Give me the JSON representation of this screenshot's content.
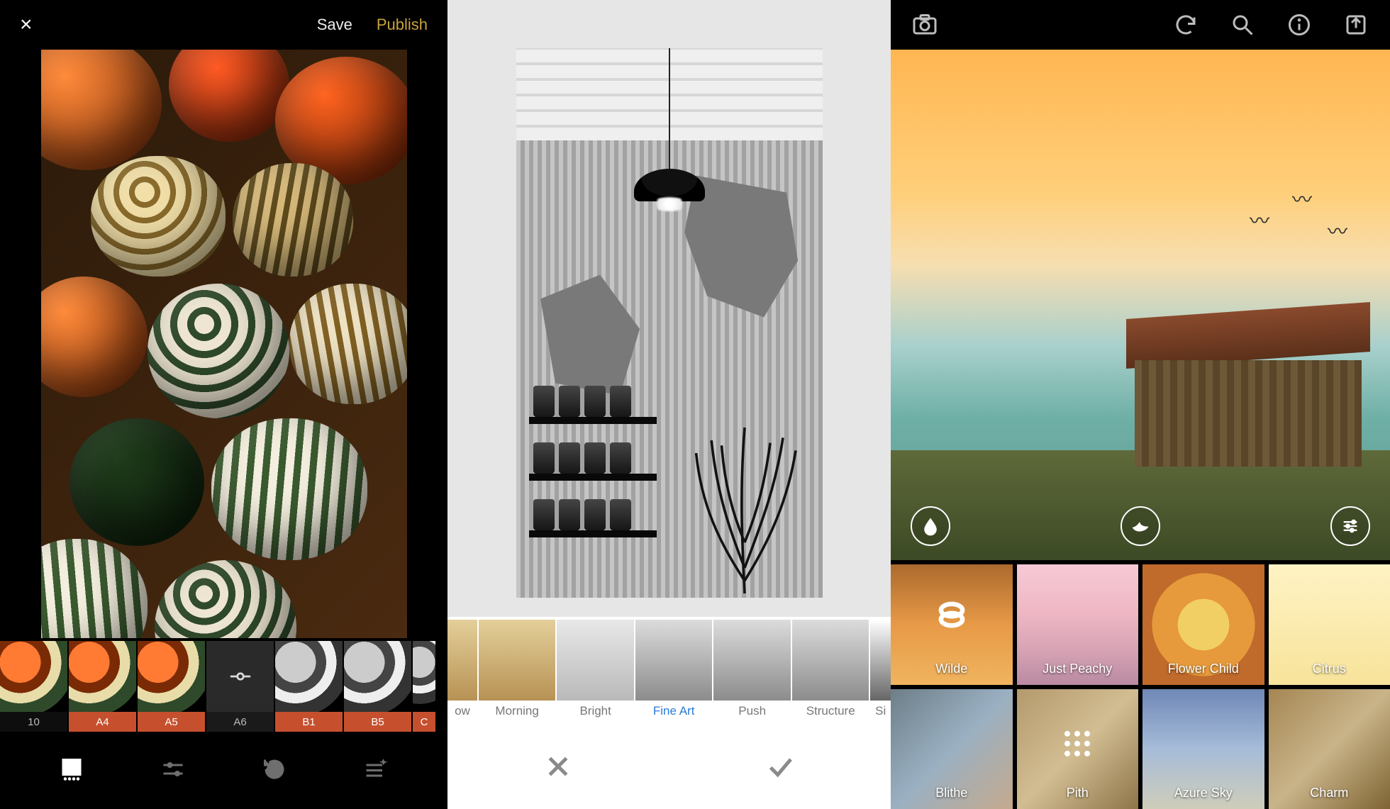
{
  "panelA": {
    "close_icon": "×",
    "save_label": "Save",
    "publish_label": "Publish",
    "publish_color": "#c9a23e",
    "filters": [
      {
        "label": "10",
        "style": "plain",
        "thumb": "color"
      },
      {
        "label": "A4",
        "style": "orange",
        "thumb": "color"
      },
      {
        "label": "A5",
        "style": "orange",
        "thumb": "color"
      },
      {
        "label": "A6",
        "style": "dark",
        "thumb": "tool"
      },
      {
        "label": "B1",
        "style": "orange",
        "thumb": "bw"
      },
      {
        "label": "B5",
        "style": "orange",
        "thumb": "bw"
      },
      {
        "label": "C",
        "style": "orange",
        "thumb": "bw"
      }
    ],
    "tabs": [
      "presets",
      "sliders",
      "history",
      "tools"
    ]
  },
  "panelB": {
    "filters": [
      {
        "label": "ow",
        "cut": "l"
      },
      {
        "label": "Morning"
      },
      {
        "label": "Bright"
      },
      {
        "label": "Fine Art",
        "active": true
      },
      {
        "label": "Push"
      },
      {
        "label": "Structure"
      },
      {
        "label": "Si",
        "cut": "r"
      }
    ],
    "actions": {
      "cancel": "cancel",
      "confirm": "confirm"
    }
  },
  "panelC": {
    "header_icons": {
      "camera": "camera",
      "undo": "undo",
      "search": "search",
      "info": "info",
      "share": "share"
    },
    "overlay_icons": {
      "drop": "drop",
      "bird": "bird",
      "sliders": "sliders"
    },
    "textures_row1": [
      {
        "label": "Wilde",
        "bg": "bg-wilde",
        "icon": "rings",
        "selected": true
      },
      {
        "label": "Just Peachy",
        "bg": "bg-peachy"
      },
      {
        "label": "Flower Child",
        "bg": "bg-flower"
      },
      {
        "label": "Citrus",
        "bg": "bg-citrus"
      }
    ],
    "textures_row2": [
      {
        "label": "Blithe",
        "bg": "bg-blithe"
      },
      {
        "label": "Pith",
        "bg": "bg-pith",
        "icon": "dots"
      },
      {
        "label": "Azure Sky",
        "bg": "bg-azure"
      },
      {
        "label": "Charm",
        "bg": "bg-charm"
      }
    ]
  }
}
